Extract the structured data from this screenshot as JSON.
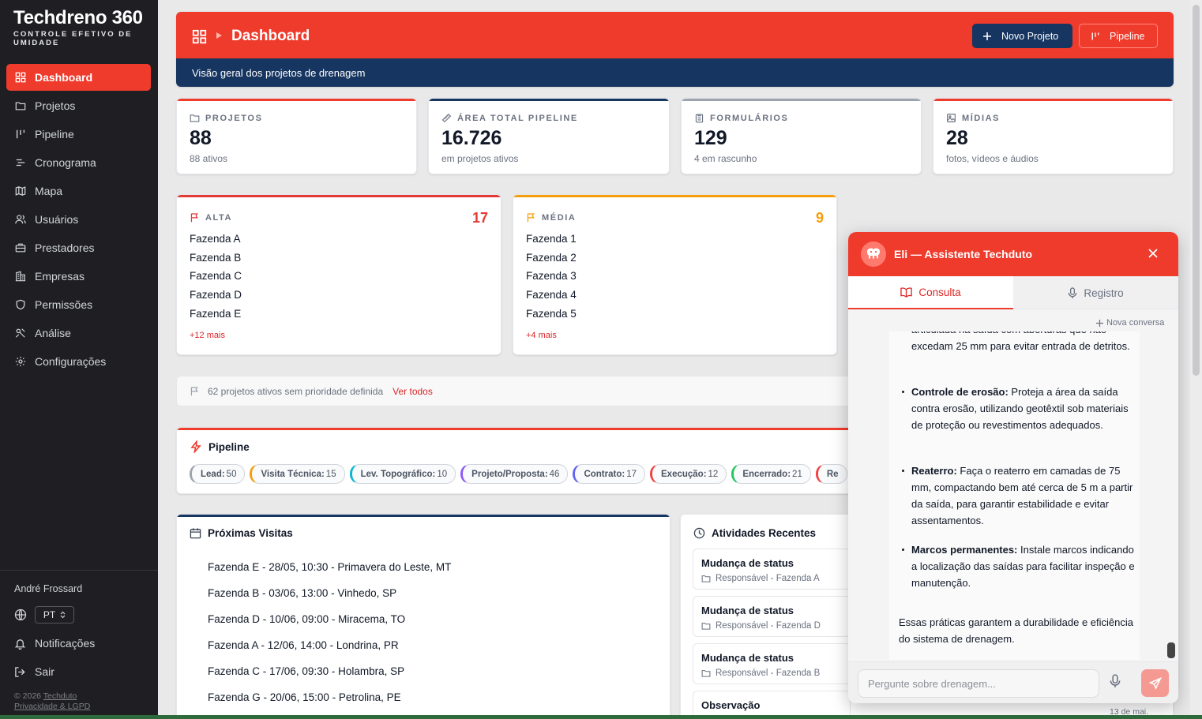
{
  "brand": {
    "name": "Techdreno 360",
    "tagline": "CONTROLE EFETIVO DE UMIDADE"
  },
  "sidebar": {
    "items": [
      {
        "label": "Dashboard",
        "icon": "dashboard-icon"
      },
      {
        "label": "Projetos",
        "icon": "folder-icon"
      },
      {
        "label": "Pipeline",
        "icon": "pipeline-icon"
      },
      {
        "label": "Cronograma",
        "icon": "timeline-icon"
      },
      {
        "label": "Mapa",
        "icon": "map-icon"
      },
      {
        "label": "Usuários",
        "icon": "users-icon"
      },
      {
        "label": "Prestadores",
        "icon": "briefcase-icon"
      },
      {
        "label": "Empresas",
        "icon": "building-icon"
      },
      {
        "label": "Permissões",
        "icon": "shield-icon"
      },
      {
        "label": "Análise",
        "icon": "analysis-icon"
      },
      {
        "label": "Configurações",
        "icon": "gear-icon"
      }
    ],
    "user": "André Frossard",
    "language": "PT",
    "notifications": "Notificações",
    "logout": "Sair",
    "copyright": "© 2026",
    "company": "Techduto",
    "privacy": "Privacidade & LGPD"
  },
  "header": {
    "title": "Dashboard",
    "subtitle": "Visão geral dos projetos de drenagem",
    "new_project": "Novo Projeto",
    "pipeline": "Pipeline"
  },
  "stats": [
    {
      "label": "PROJETOS",
      "value": "88",
      "sub": "88 ativos",
      "color": "#ef3b2c"
    },
    {
      "label": "ÁREA TOTAL PIPELINE",
      "value": "16.726",
      "sub": "em projetos ativos",
      "color": "#163560"
    },
    {
      "label": "FORMULÁRIOS",
      "value": "129",
      "sub": "4 em rascunho",
      "color": "#9ca3af"
    },
    {
      "label": "MÍDIAS",
      "value": "28",
      "sub": "fotos, vídeos e áudios",
      "color": "#ef3b2c"
    }
  ],
  "priority": {
    "alta": {
      "label": "ALTA",
      "count": "17",
      "items": [
        "Fazenda A",
        "Fazenda B",
        "Fazenda C",
        "Fazenda D",
        "Fazenda E"
      ],
      "more": "+12 mais",
      "color": "#e53935"
    },
    "media": {
      "label": "MÉDIA",
      "count": "9",
      "items": [
        "Fazenda 1",
        "Fazenda 2",
        "Fazenda 3",
        "Fazenda 4",
        "Fazenda 5"
      ],
      "more": "+4 mais",
      "color": "#f59e0b"
    },
    "none_text": "62 projetos ativos sem prioridade definida",
    "see_all": "Ver todos"
  },
  "pipeline": {
    "title": "Pipeline",
    "stages": [
      {
        "label": "Lead:",
        "count": "50",
        "color": "#9ca3af"
      },
      {
        "label": "Visita Técnica:",
        "count": "15",
        "color": "#f59e0b"
      },
      {
        "label": "Lev. Topográfico:",
        "count": "10",
        "color": "#06b6d4"
      },
      {
        "label": "Projeto/Proposta:",
        "count": "46",
        "color": "#8b5cf6"
      },
      {
        "label": "Contrato:",
        "count": "17",
        "color": "#6366f1"
      },
      {
        "label": "Execução:",
        "count": "12",
        "color": "#ef4444"
      },
      {
        "label": "Encerrado:",
        "count": "21",
        "color": "#22c55e"
      },
      {
        "label": "Re",
        "count": "",
        "color": "#ef4444"
      }
    ]
  },
  "visits": {
    "title": "Próximas Visitas",
    "items": [
      "Fazenda E - 28/05, 10:30 - Primavera do Leste, MT",
      "Fazenda B - 03/06, 13:00 - Vinhedo, SP",
      "Fazenda D - 10/06, 09:00  - Miracema, TO",
      "Fazenda A - 12/06, 14:00 - Londrina, PR",
      "Fazenda C - 17/06, 09:30 - Holambra, SP",
      "Fazenda G - 20/06, 15:00 - Petrolina, PE"
    ]
  },
  "activities": {
    "title": "Atividades Recentes",
    "items": [
      {
        "title": "Mudança de status",
        "sub": "Responsável - Fazenda A"
      },
      {
        "title": "Mudança de status",
        "sub": "Responsável - Fazenda D"
      },
      {
        "title": "Mudança de status",
        "sub": "Responsável - Fazenda B"
      },
      {
        "title": "Observação",
        "sub": ""
      }
    ],
    "date": "13 de mai."
  },
  "chat": {
    "title": "Eli — Assistente Techduto",
    "tab_consulta": "Consulta",
    "tab_registro": "Registro",
    "new_conversation": "Nova conversa",
    "intro": "articulada na saída com aberturas que não excedam 25 mm para evitar entrada de detritos.",
    "bullets": [
      {
        "bold": "Controle de erosão:",
        "text": " Proteja a área da saída contra erosão, utilizando geotêxtil sob materiais de proteção ou revestimentos adequados."
      },
      {
        "bold": "Reaterro:",
        "text": " Faça o reaterro em camadas de 75 mm, compactando bem até cerca de 5 m a partir da saída, para garantir estabilidade e evitar assentamentos."
      },
      {
        "bold": "Marcos permanentes:",
        "text": " Instale marcos indicando a localização das saídas para facilitar inspeção e manutenção."
      }
    ],
    "outro": "Essas práticas garantem a durabilidade e eficiência do sistema de drenagem.",
    "placeholder": "Pergunte sobre drenagem..."
  }
}
